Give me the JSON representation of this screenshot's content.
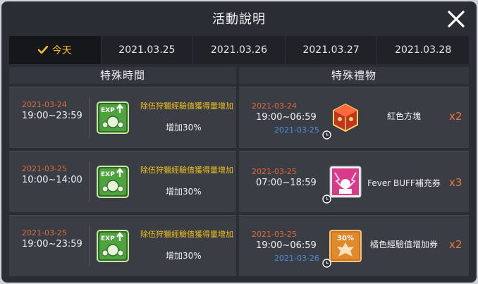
{
  "title": "活動說明",
  "tabs": [
    {
      "label": "今天"
    },
    {
      "label": "2021.03.25"
    },
    {
      "label": "2021.03.26"
    },
    {
      "label": "2021.03.27"
    },
    {
      "label": "2021.03.28"
    }
  ],
  "special_time": {
    "heading": "特殊時間",
    "rows": [
      {
        "date": "2021-03-24",
        "time": "19:00~23:59",
        "effect": "除伍狩獵經驗值獲得量增加",
        "amount": "增加30%",
        "icon": "exp-up-icon"
      },
      {
        "date": "2021-03-25",
        "time": "10:00~14:00",
        "effect": "除伍狩獵經驗值獲得量增加",
        "amount": "增加30%",
        "icon": "exp-up-icon"
      },
      {
        "date": "2021-03-25",
        "time": "19:00~23:59",
        "effect": "除伍狩獵經驗值獲得量增加",
        "amount": "增加30%",
        "icon": "exp-up-icon"
      }
    ]
  },
  "special_gift": {
    "heading": "特殊禮物",
    "rows": [
      {
        "date": "2021-03-24",
        "time": "19:00~06:59",
        "end_date": "2021-03-25",
        "name": "紅色方塊",
        "qty": "x2",
        "icon": "red-cube-icon"
      },
      {
        "date": "2021-03-25",
        "time": "07:00~18:59",
        "end_date": "",
        "name": "Fever BUFF補充券",
        "qty": "x3",
        "icon": "fever-buff-ticket-icon"
      },
      {
        "date": "2021-03-25",
        "time": "19:00~06:59",
        "end_date": "2021-03-26",
        "name": "橘色經驗值增加券",
        "qty": "x2",
        "icon": "orange-exp-coupon-icon"
      }
    ],
    "coupon_badge": "30%"
  },
  "colors": {
    "accent": "#f3c020",
    "date": "#e06a3a",
    "end_date": "#4a8fe0",
    "qty": "#e8783a",
    "panel": "#2a2d33"
  }
}
